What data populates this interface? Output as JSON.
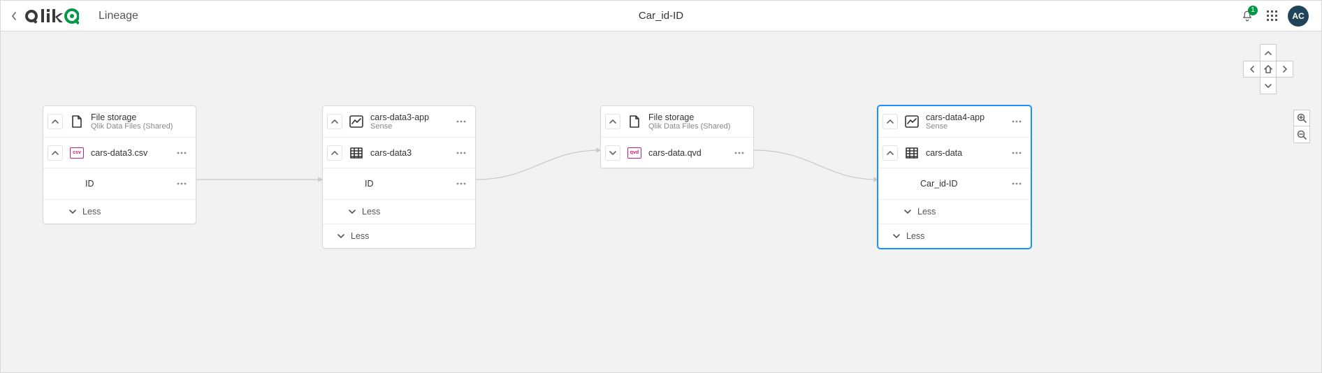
{
  "app": {
    "breadcrumb_label": "Lineage",
    "page_title": "Car_id-ID",
    "notification_count": "1",
    "avatar_initials": "AC"
  },
  "nodes": {
    "n1": {
      "title": "File storage",
      "subtitle": "Qlik Data Files (Shared)",
      "child_title": "cars-data3.csv",
      "field": "ID",
      "less": "Less"
    },
    "n2": {
      "title": "cars-data3-app",
      "subtitle": "Sense",
      "child_title": "cars-data3",
      "field": "ID",
      "less_inner": "Less",
      "less": "Less"
    },
    "n3": {
      "title": "File storage",
      "subtitle": "Qlik Data Files (Shared)",
      "child_title": "cars-data.qvd"
    },
    "n4": {
      "title": "cars-data4-app",
      "subtitle": "Sense",
      "child_title": "cars-data",
      "field": "Car_id-ID",
      "less_inner": "Less",
      "less": "Less"
    }
  }
}
